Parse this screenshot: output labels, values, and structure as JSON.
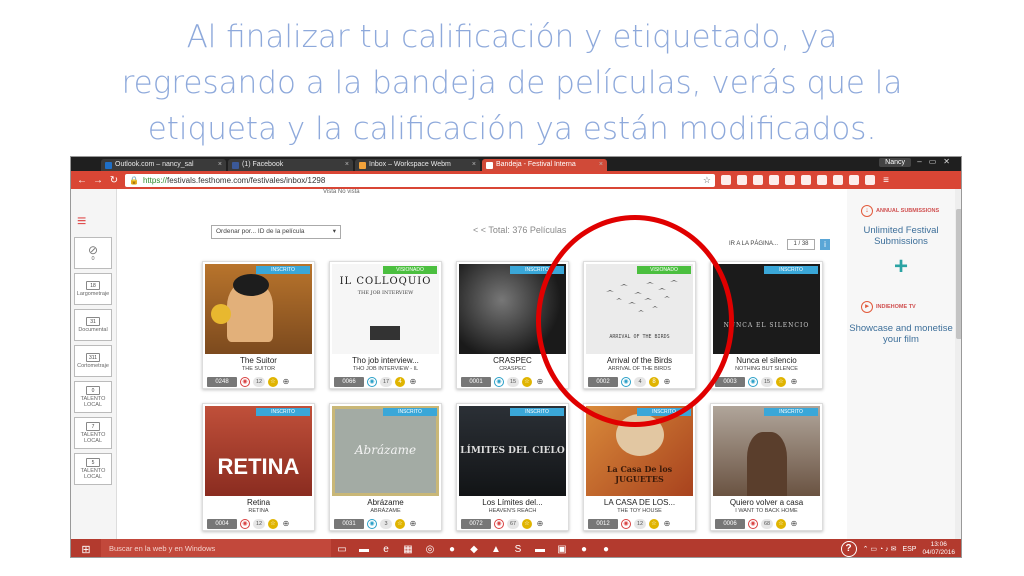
{
  "caption": {
    "line1": "Al finalizar tu calificación y etiquetado, ya",
    "line2": "regresando a la bandeja de películas, verás que la",
    "line3": "etiqueta y la calificación ya están modificados."
  },
  "browser": {
    "tabs": [
      {
        "label": "Outlook.com – nancy_sal",
        "color": "#1f6fc6",
        "active": false
      },
      {
        "label": "(1) Facebook",
        "color": "#3b5998",
        "active": false
      },
      {
        "label": "Inbox – Workspace Webm",
        "color": "#f2a23a",
        "active": false
      },
      {
        "label": "Bandeja - Festival Interna",
        "color": "#e25b3c",
        "active": true
      }
    ],
    "user": "Nancy",
    "url_secure": "https://",
    "url_rest": "festivals.festhome.com/festivales/inbox/1298"
  },
  "sidebar": {
    "items": [
      {
        "count": "0",
        "label": ""
      },
      {
        "count": "18",
        "label": "Largometraje"
      },
      {
        "count": "31",
        "label": "Documental"
      },
      {
        "count": "311",
        "label": "Cortometraje"
      },
      {
        "count": "0",
        "label": "TALENTO LOCAL"
      },
      {
        "count": "7",
        "label": "TALENTO LOCAL"
      },
      {
        "count": "5",
        "label": "TALENTO LOCAL"
      }
    ]
  },
  "toolbar": {
    "views": "Vista  No vista",
    "sort": "Ordenar por... ID de la película",
    "total": "< < Total: 376 Películas",
    "goto": "IR A LA PÁGINA...",
    "page": "1 / 38"
  },
  "cards": [
    {
      "status": "INSCRITO",
      "status_color": "blue",
      "title": "The Suitor",
      "subtitle": "THE SUITOR",
      "id": "0248",
      "rating": "12",
      "eye": "red",
      "poster_bg": "#c8843a",
      "poster_text": ""
    },
    {
      "status": "VISIONADO",
      "status_color": "green",
      "title": "Tho job interview...",
      "subtitle": "THO JOB INTERVIEW - IL",
      "id": "0066",
      "rating": "17",
      "eye": "blue",
      "poster_bg": "#f4f4f4",
      "poster_text": "IL COLLOQUIO"
    },
    {
      "status": "INSCRITO",
      "status_color": "blue",
      "title": "CRASPEC",
      "subtitle": "CRASPEC",
      "id": "0001",
      "rating": "15",
      "eye": "blue",
      "poster_bg": "#2a2a2a",
      "poster_text": ""
    },
    {
      "status": "VISIONADO",
      "status_color": "green",
      "title": "Arrival of the Birds",
      "subtitle": "ARRIVAL OF THE BIRDS",
      "id": "0002",
      "rating": "4",
      "eye": "blue",
      "poster_bg": "#e9e9e9",
      "poster_text": "ARRIVAL OF THE BIRDS"
    },
    {
      "status": "INSCRITO",
      "status_color": "blue",
      "title": "Nunca el silencio",
      "subtitle": "NOTHING BUT SILENCE",
      "id": "0003",
      "rating": "15",
      "eye": "blue",
      "poster_bg": "#1b1b1b",
      "poster_text": "NUNCA EL SILENCIO"
    },
    {
      "status": "INSCRITO",
      "status_color": "blue",
      "title": "Retina",
      "subtitle": "RETINA",
      "id": "0004",
      "rating": "12",
      "eye": "red",
      "poster_bg": "#b3412c",
      "poster_text": "RETINA"
    },
    {
      "status": "INSCRITO",
      "status_color": "blue",
      "title": "Abrázame",
      "subtitle": "ABRÁZAME",
      "id": "0031",
      "rating": "3",
      "eye": "blue",
      "poster_bg": "#9fa7a0",
      "poster_text": "Abrázame"
    },
    {
      "status": "INSCRITO",
      "status_color": "blue",
      "title": "Los Límites del...",
      "subtitle": "HEAVEN'S REACH",
      "id": "0072",
      "rating": "67",
      "eye": "red",
      "poster_bg": "#2b3036",
      "poster_text": "LÍMITES DEL CIELO"
    },
    {
      "status": "INSCRITO",
      "status_color": "blue",
      "title": "LA CASA DE LOS...",
      "subtitle": "THE TOY HOUSE",
      "id": "0012",
      "rating": "12",
      "eye": "red",
      "poster_bg": "#c96a2c",
      "poster_text": "La Casa De los JUGUETES"
    },
    {
      "status": "INSCRITO",
      "status_color": "blue",
      "title": "Quiero volver a casa",
      "subtitle": "I WANT TO BACK HOME",
      "id": "0006",
      "rating": "68",
      "eye": "red",
      "poster_bg": "#8a6e58",
      "poster_text": ""
    }
  ],
  "right_panel": {
    "annual_btn": "ANNUAL SUBMISSIONS",
    "unlimited": "Unlimited Festival Submissions",
    "indiehome_btn": "INDIEHOME TV",
    "showcase": "Showcase and monetise your film"
  },
  "taskbar": {
    "search": "Buscar en la web y en Windows",
    "lang": "ESP",
    "time": "13:06",
    "date": "04/07/2016"
  }
}
